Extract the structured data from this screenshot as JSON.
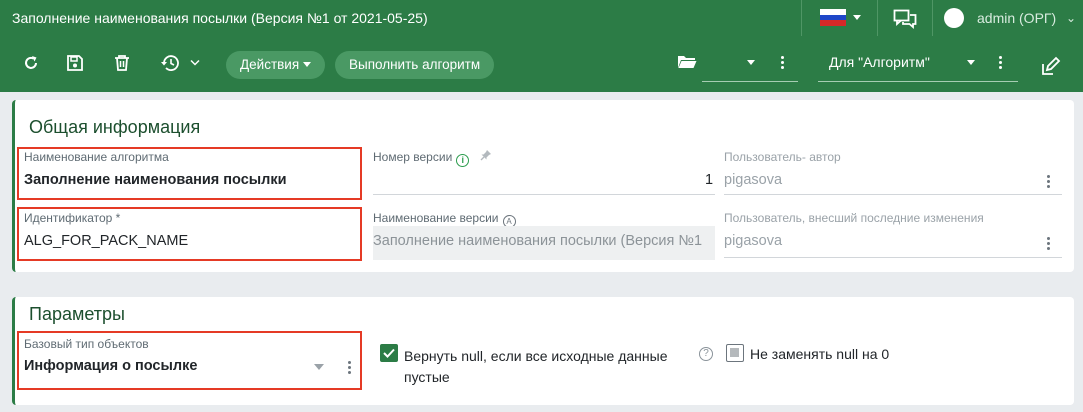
{
  "window": {
    "title": "Заполнение наименования посылки (Версия №1 от 2021-05-25)",
    "user": "admin (ОРГ)",
    "user_caret": "⌄"
  },
  "toolbar": {
    "actions_label": "Действия",
    "run_label": "Выполнить алгоритм",
    "for_label": "Для \"Алгоритм\"",
    "folder_select_value": ""
  },
  "colors": {
    "brand_green": "#2c7c46",
    "highlight_red": "#e53a25"
  },
  "general": {
    "title": "Общая информация",
    "algorithm_name": {
      "label": "Наименование алгоритма",
      "value": "Заполнение наименования посылки"
    },
    "identifier": {
      "label": "Идентификатор *",
      "value": "ALG_FOR_PACK_NAME"
    },
    "version_number": {
      "label": "Номер версии",
      "value": "1"
    },
    "version_name": {
      "label": "Наименование версии",
      "value": "Заполнение наименования посылки (Версия №1"
    },
    "author": {
      "label": "Пользователь- автор",
      "value": "pigasova"
    },
    "last_modifier": {
      "label": "Пользователь, внесший последние изменения",
      "value": "pigasova"
    }
  },
  "params": {
    "title": "Параметры",
    "base_type": {
      "label": "Базовый тип объектов",
      "value": "Информация о посылке"
    },
    "return_null": {
      "label": "Вернуть null, если все исходные данные пустые",
      "checked": true
    },
    "keep_null": {
      "label": "Не заменять null на 0",
      "checked": false
    }
  },
  "icons": {
    "refresh": "refresh-icon",
    "save": "save-icon",
    "delete": "trash-icon",
    "history": "history-icon",
    "folder": "folder-icon",
    "edit": "edit-icon",
    "chat": "chat-icon",
    "flag": "russian-flag-icon",
    "info": "info-icon",
    "pin": "pin-icon",
    "auto": "auto-icon",
    "help": "help-icon"
  }
}
